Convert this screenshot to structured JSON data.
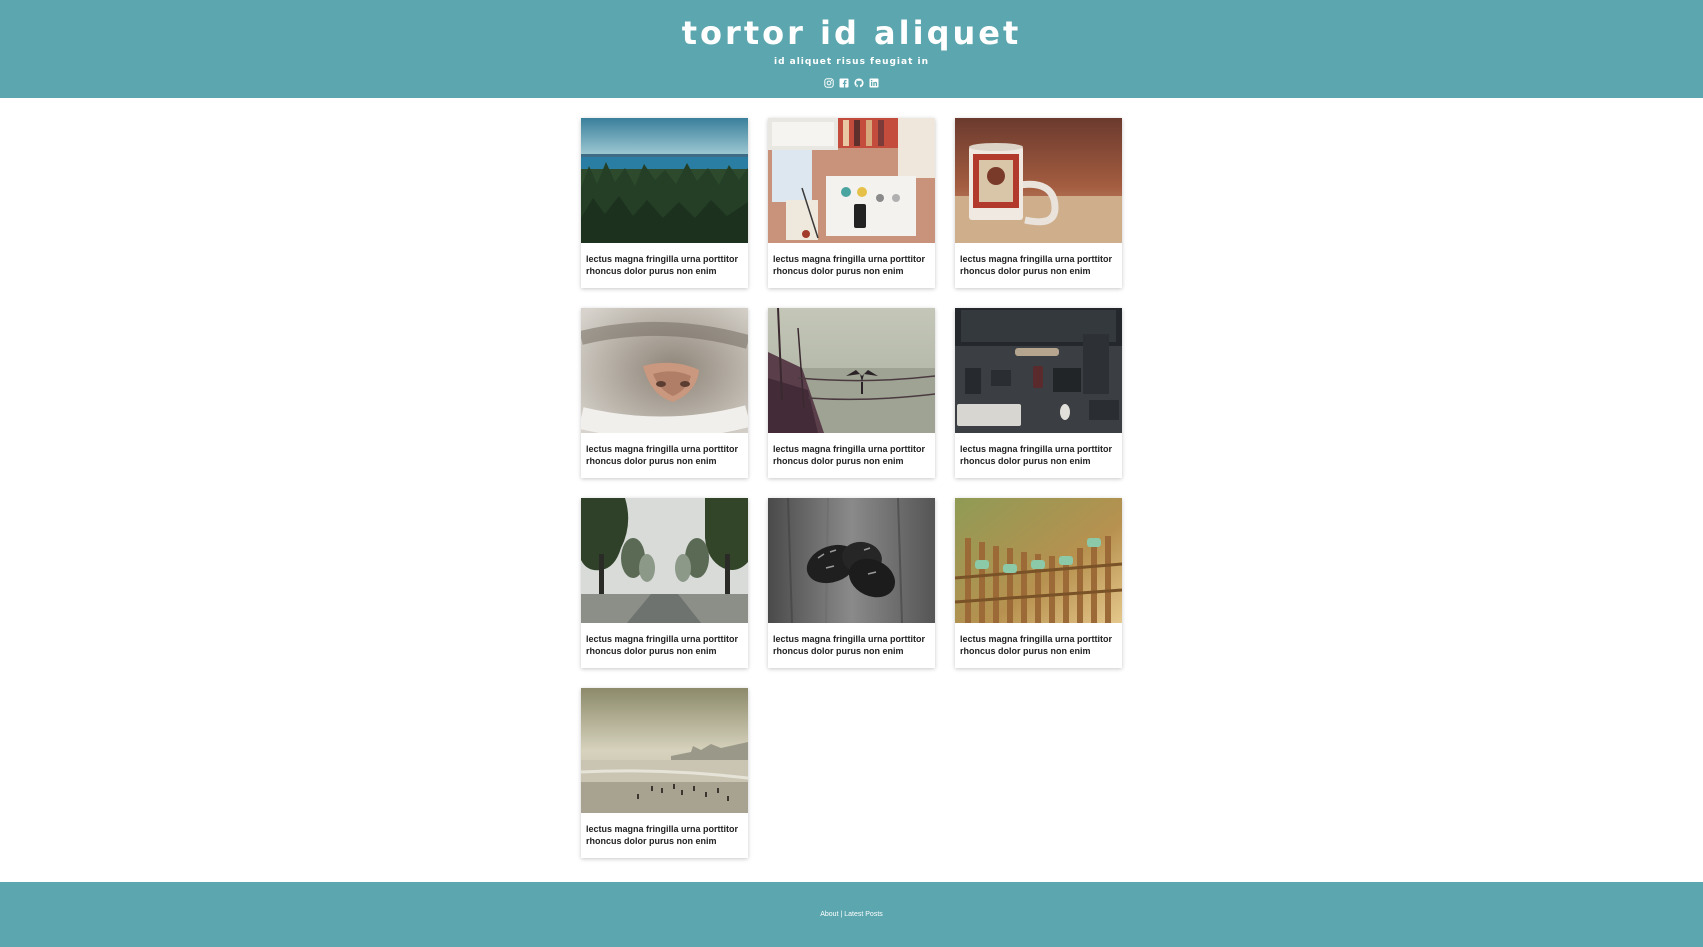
{
  "header": {
    "title": "tortor id aliquet",
    "subtitle": "id aliquet risus feugiat in",
    "social_icons": [
      "instagram-icon",
      "facebook-icon",
      "github-icon",
      "linkedin-icon"
    ]
  },
  "posts": [
    {
      "caption": "lectus magna fringilla urna porttitor rhoncus dolor purus non enim",
      "image": "forest-and-lake-photo"
    },
    {
      "caption": "lectus magna fringilla urna porttitor rhoncus dolor purus non enim",
      "image": "desk-flatlay-photo"
    },
    {
      "caption": "lectus magna fringilla urna porttitor rhoncus dolor purus non enim",
      "image": "mug-photo"
    },
    {
      "caption": "lectus magna fringilla urna porttitor rhoncus dolor purus non enim",
      "image": "cat-nose-photo"
    },
    {
      "caption": "lectus magna fringilla urna porttitor rhoncus dolor purus non enim",
      "image": "boat-and-bird-photo"
    },
    {
      "caption": "lectus magna fringilla urna porttitor rhoncus dolor purus non enim",
      "image": "workspace-topdown-photo"
    },
    {
      "caption": "lectus magna fringilla urna porttitor rhoncus dolor purus non enim",
      "image": "tree-lined-road-photo"
    },
    {
      "caption": "lectus magna fringilla urna porttitor rhoncus dolor purus non enim",
      "image": "pinecones-photo"
    },
    {
      "caption": "lectus magna fringilla urna porttitor rhoncus dolor purus non enim",
      "image": "fence-photo"
    },
    {
      "caption": "lectus magna fringilla urna porttitor rhoncus dolor purus non enim",
      "image": "beach-photo"
    }
  ],
  "footer": {
    "about_label": "About",
    "separator": "|",
    "latest_label": "Latest Posts"
  },
  "colors": {
    "accent": "#5ca7af",
    "background": "#ffffff",
    "caption_text": "#222222"
  }
}
